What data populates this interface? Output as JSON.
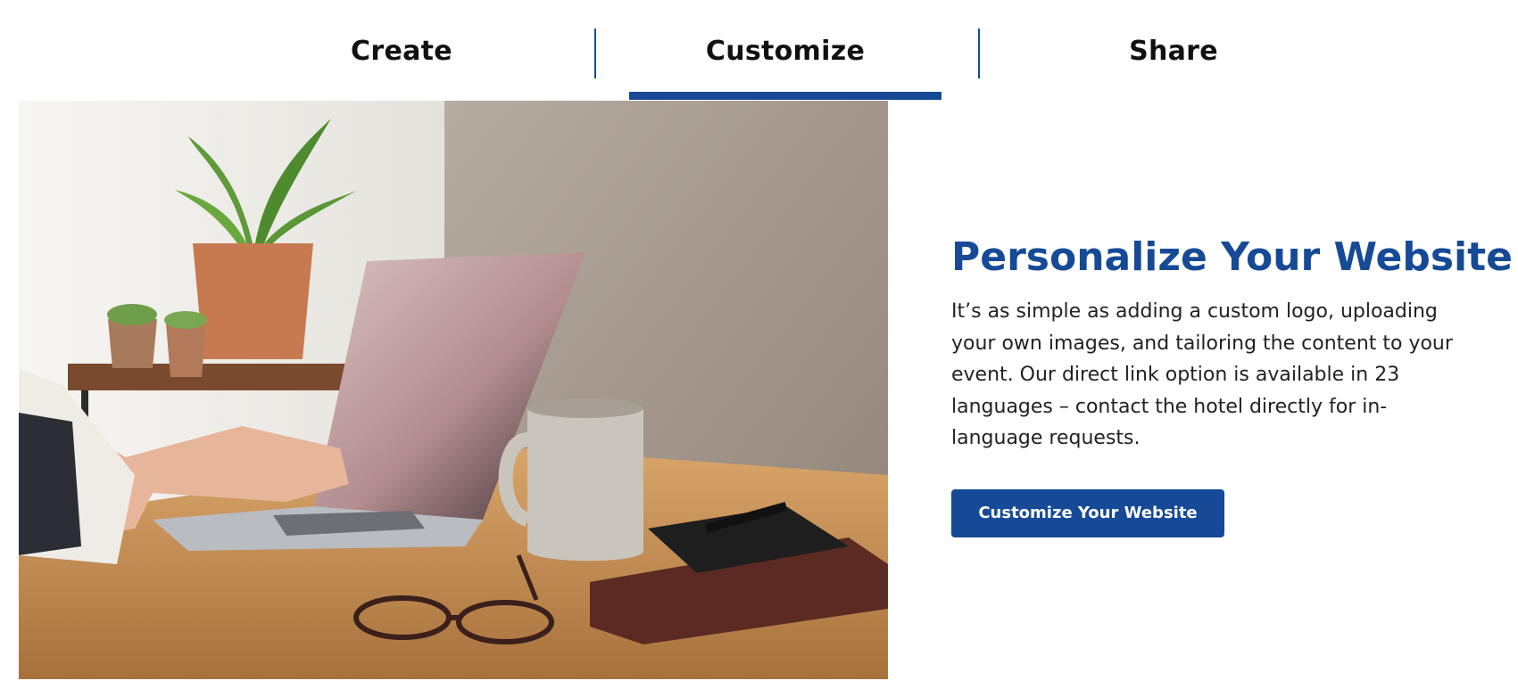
{
  "tabs": [
    {
      "label": "Create",
      "selected": false
    },
    {
      "label": "Customize",
      "selected": true
    },
    {
      "label": "Share",
      "selected": false
    }
  ],
  "colors": {
    "brand_blue": "#164a96",
    "text_dark": "#222222",
    "background": "#ffffff"
  },
  "hero_image": {
    "icon": "laptop-workspace-photo"
  },
  "promo": {
    "title": "Personalize Your Website",
    "body": "It’s as simple as adding a custom logo, uploading your own images, and tailoring the content to your event. Our direct link option is available in 23 languages – contact the hotel directly for in-language requests.",
    "button_label": "Customize Your Website"
  }
}
